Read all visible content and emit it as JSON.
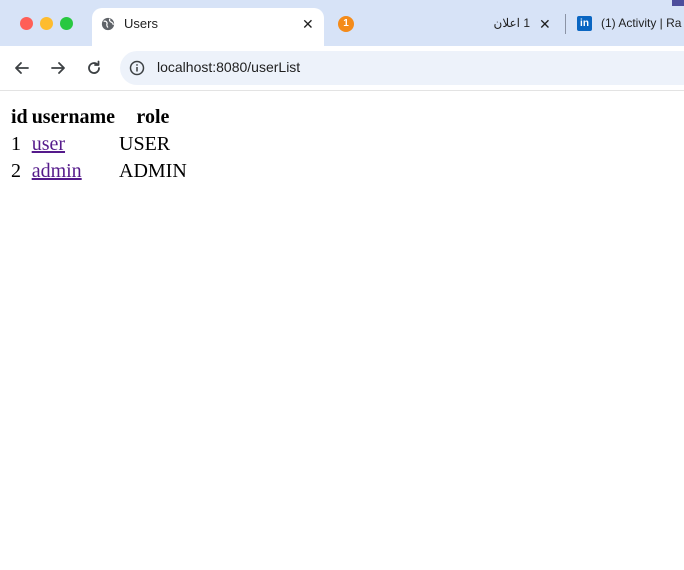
{
  "browser": {
    "tabs": [
      {
        "title": "Users",
        "active": true
      },
      {
        "badge": "1",
        "title": "1 اعلان"
      },
      {
        "title": "(1) Activity | Ra"
      }
    ],
    "address": "localhost:8080/userList"
  },
  "users_table": {
    "headers": [
      "id",
      "username",
      "role"
    ],
    "rows": [
      {
        "id": "1",
        "username": "user",
        "role": "USER"
      },
      {
        "id": "2",
        "username": "admin",
        "role": "ADMIN"
      }
    ]
  },
  "icons": {
    "tab1": "globe-icon",
    "tab2": "notification-badge-icon",
    "tab3": "linkedin-icon",
    "address": "info-icon"
  },
  "colors": {
    "tabbar": "#d7e3f7",
    "link_visited": "#551a8b",
    "badge": "#f48b1a",
    "linkedin": "#0a66c2"
  }
}
